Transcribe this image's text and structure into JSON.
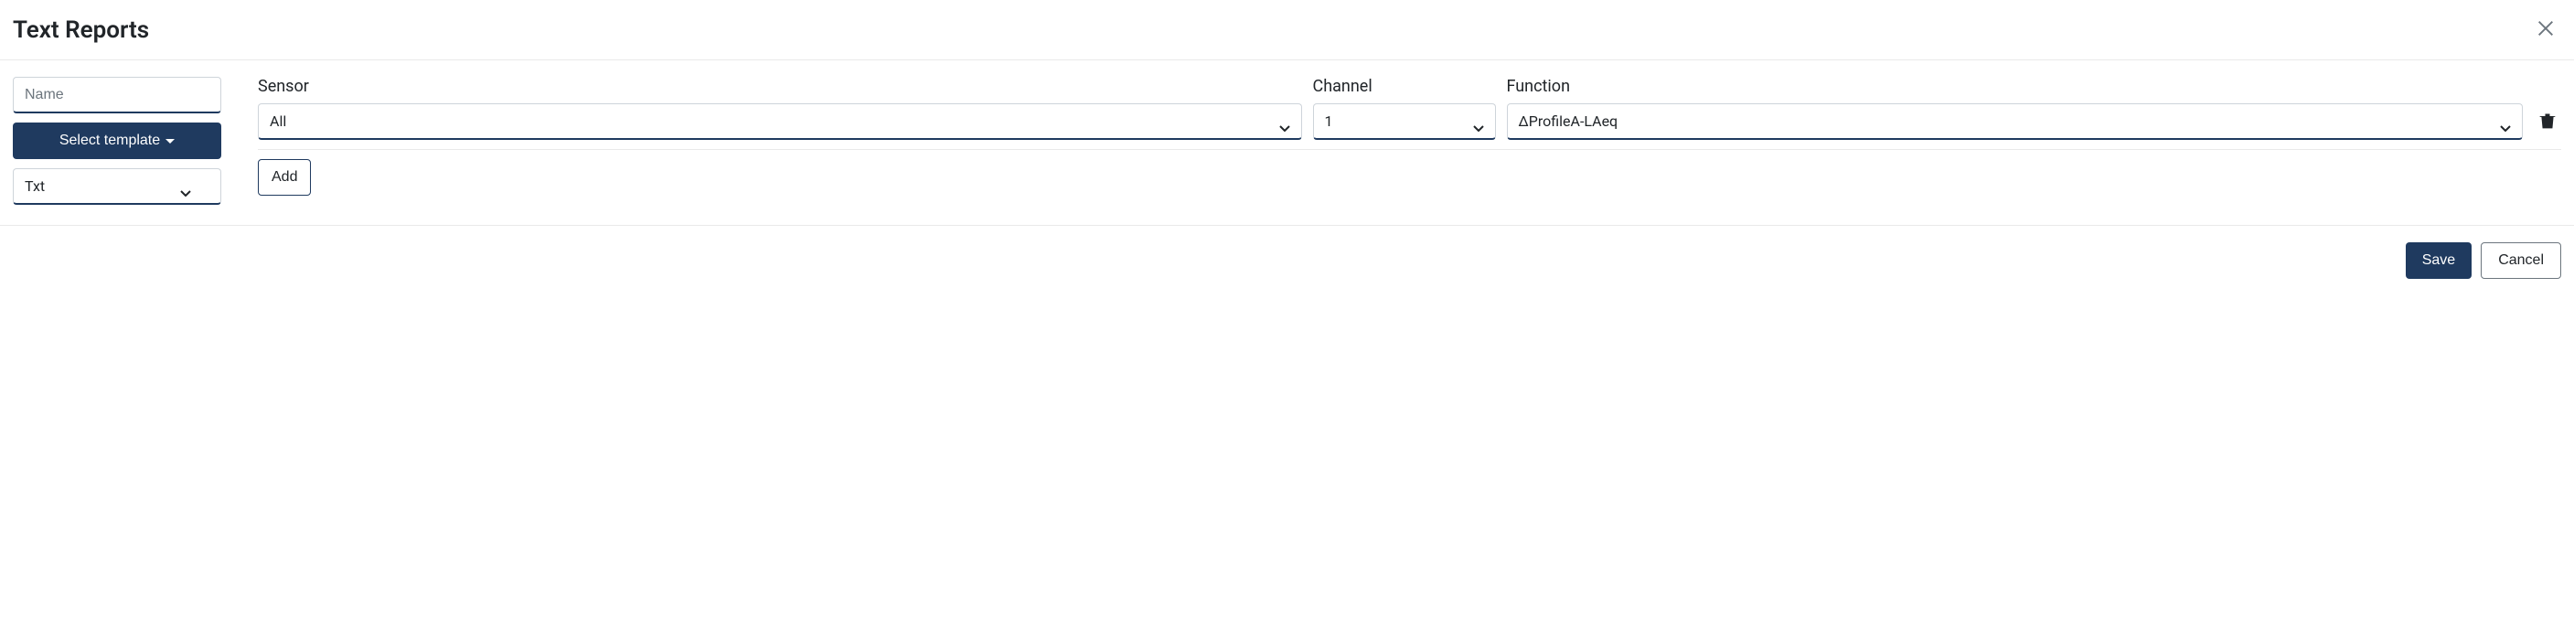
{
  "header": {
    "title": "Text Reports"
  },
  "left": {
    "name_placeholder": "Name",
    "name_value": "",
    "template_button_label": "Select template",
    "format_selected": "Txt"
  },
  "columns": {
    "sensor_label": "Sensor",
    "channel_label": "Channel",
    "function_label": "Function"
  },
  "rows": [
    {
      "sensor": "All",
      "channel": "1",
      "function": "ΔProfileA-LAeq"
    }
  ],
  "buttons": {
    "add_label": "Add",
    "save_label": "Save",
    "cancel_label": "Cancel"
  }
}
